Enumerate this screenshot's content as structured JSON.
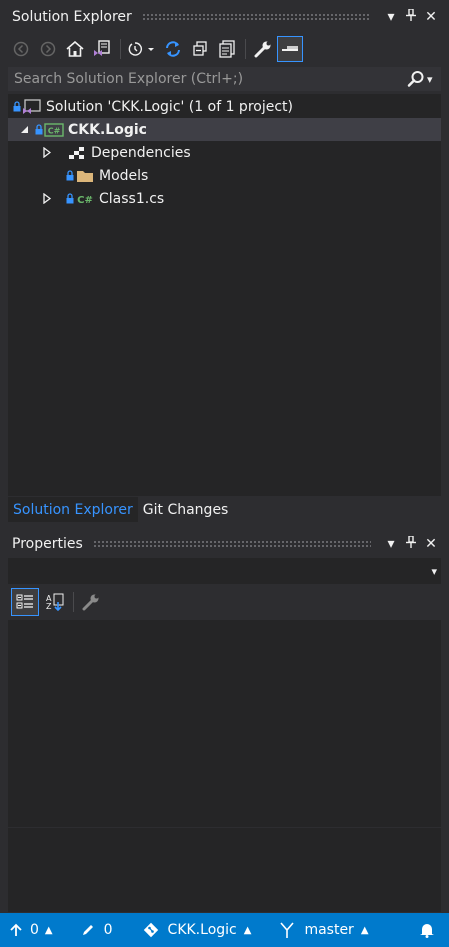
{
  "solution_explorer": {
    "title": "Solution Explorer",
    "search_placeholder": "Search Solution Explorer (Ctrl+;)",
    "tree": [
      {
        "label": "Solution 'CKK.Logic' (1 of 1 project)",
        "icon": "solution-icon",
        "bold": false
      },
      {
        "label": "CKK.Logic",
        "icon": "csharp-project-icon",
        "bold": true,
        "selected": true
      },
      {
        "label": "Dependencies",
        "icon": "dependencies-icon"
      },
      {
        "label": "Models",
        "icon": "folder-icon"
      },
      {
        "label": "Class1.cs",
        "icon": "csharp-file-icon"
      }
    ],
    "tabs": [
      {
        "label": "Solution Explorer",
        "active": true
      },
      {
        "label": "Git Changes",
        "active": false
      }
    ]
  },
  "properties": {
    "title": "Properties"
  },
  "status_bar": {
    "push_count": "0",
    "edit_count": "0",
    "repository": "CKK.Logic",
    "branch": "master"
  },
  "colors": {
    "background": "#2d2d30",
    "panel": "#252526",
    "accent": "#007acc",
    "link": "#3794ff",
    "folder": "#dcb67a",
    "csharp": "#6bb86b"
  }
}
